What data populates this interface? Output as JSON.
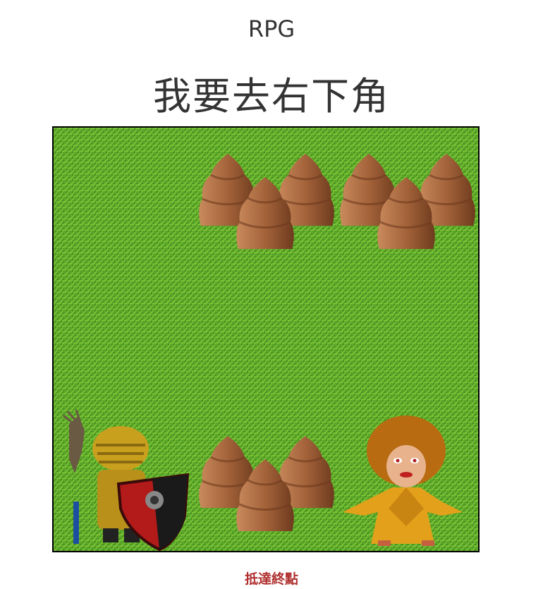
{
  "header": {
    "title": "RPG",
    "subtitle": "我要去右下角"
  },
  "board": {
    "grid_cols": 6,
    "grid_rows": 6,
    "sprites": [
      {
        "type": "rock-cluster",
        "col": 2,
        "row": 0
      },
      {
        "type": "rock-cluster",
        "col": 4,
        "row": 0
      },
      {
        "type": "rock-cluster",
        "col": 2,
        "row": 4
      },
      {
        "type": "warrior",
        "col": 0,
        "row": 4
      },
      {
        "type": "monk-npc",
        "col": 4,
        "row": 4
      }
    ],
    "colors": {
      "grass": "#5aa62a",
      "grass_light": "#8fd43a",
      "rock": "#a4633a",
      "border": "#000000"
    }
  },
  "footer": {
    "status": "抵達終點",
    "status_color": "#b03030"
  }
}
